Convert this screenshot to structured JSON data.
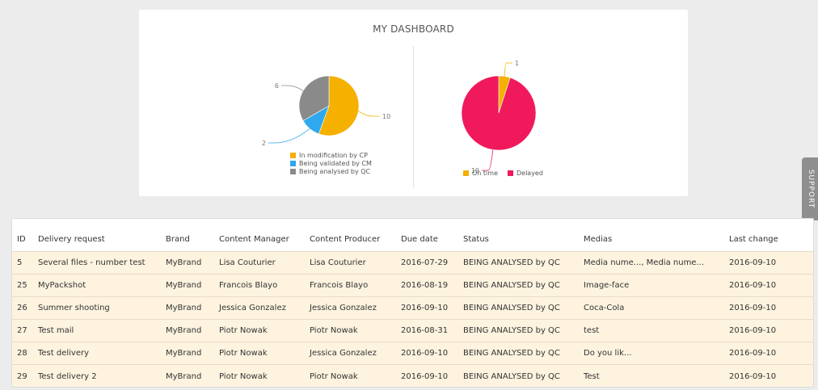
{
  "dashboard": {
    "title": "MY DASHBOARD"
  },
  "support": {
    "label": "SUPPORT"
  },
  "chart_data": [
    {
      "type": "pie",
      "categories": [
        "In modification by CP",
        "Being validated by CM",
        "Being analysed by QC"
      ],
      "values": [
        10,
        2,
        6
      ],
      "colors": [
        "#f5b000",
        "#2fa8ee",
        "#8a8a8a"
      ],
      "legend": "bottom"
    },
    {
      "type": "pie",
      "categories": [
        "On time",
        "Delayed"
      ],
      "values": [
        1,
        19
      ],
      "colors": [
        "#f5b000",
        "#f0195c"
      ],
      "legend": "bottom"
    }
  ],
  "table": {
    "headers": {
      "id": "ID",
      "request": "Delivery request",
      "brand": "Brand",
      "cm": "Content Manager",
      "cp": "Content Producer",
      "due": "Due date",
      "status": "Status",
      "medias": "Medias",
      "last": "Last change"
    },
    "rows": [
      {
        "id": "5",
        "request": "Several files - number test",
        "brand": "MyBrand",
        "cm": "Lisa Couturier",
        "cp": "Lisa Couturier",
        "due": "2016-07-29",
        "status": "BEING ANALYSED by QC",
        "medias": "Media nume..., Media nume...",
        "last": "2016-09-10"
      },
      {
        "id": "25",
        "request": "MyPackshot",
        "brand": "MyBrand",
        "cm": "Francois Blayo",
        "cp": "Francois Blayo",
        "due": "2016-08-19",
        "status": "BEING ANALYSED by QC",
        "medias": "Image-face",
        "last": "2016-09-10"
      },
      {
        "id": "26",
        "request": "Summer shooting",
        "brand": "MyBrand",
        "cm": "Jessica Gonzalez",
        "cp": "Jessica Gonzalez",
        "due": "2016-09-10",
        "status": "BEING ANALYSED by QC",
        "medias": "Coca-Cola",
        "last": "2016-09-10"
      },
      {
        "id": "27",
        "request": "Test mail",
        "brand": "MyBrand",
        "cm": "Piotr Nowak",
        "cp": "Piotr Nowak",
        "due": "2016-08-31",
        "status": "BEING ANALYSED by QC",
        "medias": "test",
        "last": "2016-09-10"
      },
      {
        "id": "28",
        "request": "Test delivery",
        "brand": "MyBrand",
        "cm": "Piotr Nowak",
        "cp": "Jessica Gonzalez",
        "due": "2016-09-10",
        "status": "BEING ANALYSED by QC",
        "medias": "Do you lik...",
        "last": "2016-09-10"
      },
      {
        "id": "29",
        "request": "Test delivery 2",
        "brand": "MyBrand",
        "cm": "Piotr Nowak",
        "cp": "Piotr Nowak",
        "due": "2016-09-10",
        "status": "BEING ANALYSED by QC",
        "medias": "Test",
        "last": "2016-09-10"
      }
    ]
  }
}
